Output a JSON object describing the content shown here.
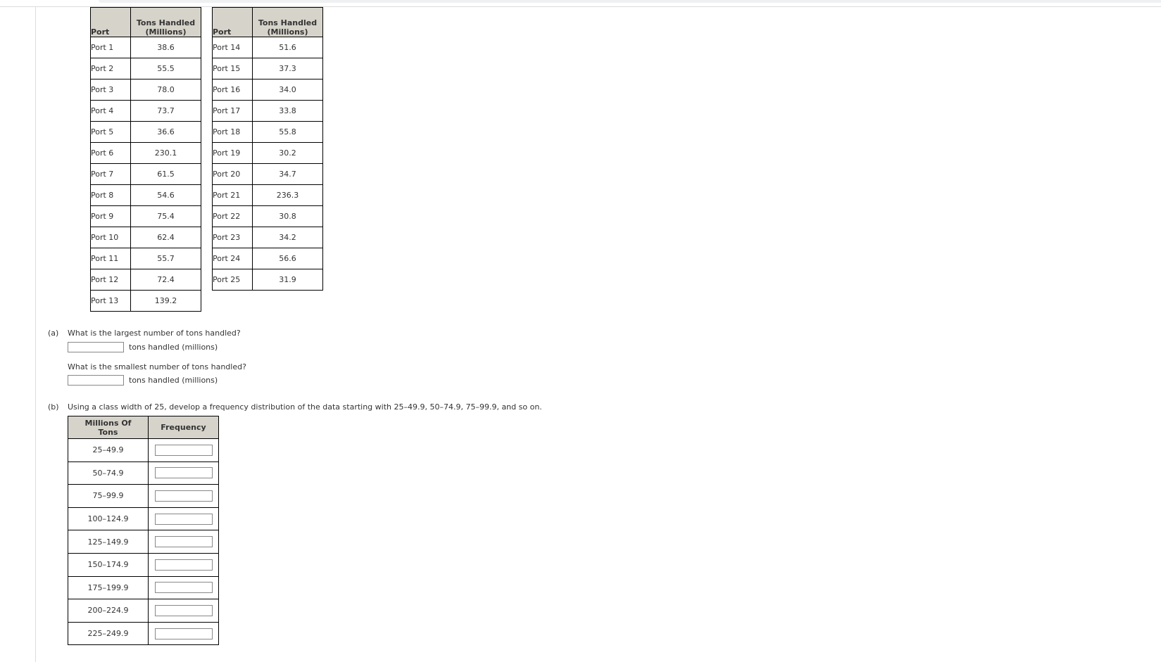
{
  "table_left": {
    "headers": {
      "port": "Port",
      "tons": "Tons Handled (Millions)"
    },
    "rows": [
      {
        "port": "Port 1",
        "tons": "38.6"
      },
      {
        "port": "Port 2",
        "tons": "55.5"
      },
      {
        "port": "Port 3",
        "tons": "78.0"
      },
      {
        "port": "Port 4",
        "tons": "73.7"
      },
      {
        "port": "Port 5",
        "tons": "36.6"
      },
      {
        "port": "Port 6",
        "tons": "230.1"
      },
      {
        "port": "Port 7",
        "tons": "61.5"
      },
      {
        "port": "Port 8",
        "tons": "54.6"
      },
      {
        "port": "Port 9",
        "tons": "75.4"
      },
      {
        "port": "Port 10",
        "tons": "62.4"
      },
      {
        "port": "Port 11",
        "tons": "55.7"
      },
      {
        "port": "Port 12",
        "tons": "72.4"
      },
      {
        "port": "Port 13",
        "tons": "139.2"
      }
    ]
  },
  "table_right": {
    "headers": {
      "port": "Port",
      "tons": "Tons Handled (Millions)"
    },
    "rows": [
      {
        "port": "Port 14",
        "tons": "51.6"
      },
      {
        "port": "Port 15",
        "tons": "37.3"
      },
      {
        "port": "Port 16",
        "tons": "34.0"
      },
      {
        "port": "Port 17",
        "tons": "33.8"
      },
      {
        "port": "Port 18",
        "tons": "55.8"
      },
      {
        "port": "Port 19",
        "tons": "30.2"
      },
      {
        "port": "Port 20",
        "tons": "34.7"
      },
      {
        "port": "Port 21",
        "tons": "236.3"
      },
      {
        "port": "Port 22",
        "tons": "30.8"
      },
      {
        "port": "Port 23",
        "tons": "34.2"
      },
      {
        "port": "Port 24",
        "tons": "56.6"
      },
      {
        "port": "Port 25",
        "tons": "31.9"
      }
    ]
  },
  "part_a": {
    "label": "(a)",
    "q1": "What is the largest number of tons handled?",
    "q1_value": "",
    "q1_unit": "tons handled (millions)",
    "q2": "What is the smallest number of tons handled?",
    "q2_value": "",
    "q2_unit": "tons handled (millions)"
  },
  "part_b": {
    "label": "(b)",
    "question": "Using a class width of 25, develop a frequency distribution of the data starting with 25–49.9, 50–74.9, 75–99.9, and so on.",
    "headers": {
      "range": "Millions Of Tons",
      "freq": "Frequency"
    },
    "rows": [
      {
        "range": "25–49.9",
        "freq": ""
      },
      {
        "range": "50–74.9",
        "freq": ""
      },
      {
        "range": "75–99.9",
        "freq": ""
      },
      {
        "range": "100–124.9",
        "freq": ""
      },
      {
        "range": "125–149.9",
        "freq": ""
      },
      {
        "range": "150–174.9",
        "freq": ""
      },
      {
        "range": "175–199.9",
        "freq": ""
      },
      {
        "range": "200–224.9",
        "freq": ""
      },
      {
        "range": "225–249.9",
        "freq": ""
      }
    ]
  }
}
